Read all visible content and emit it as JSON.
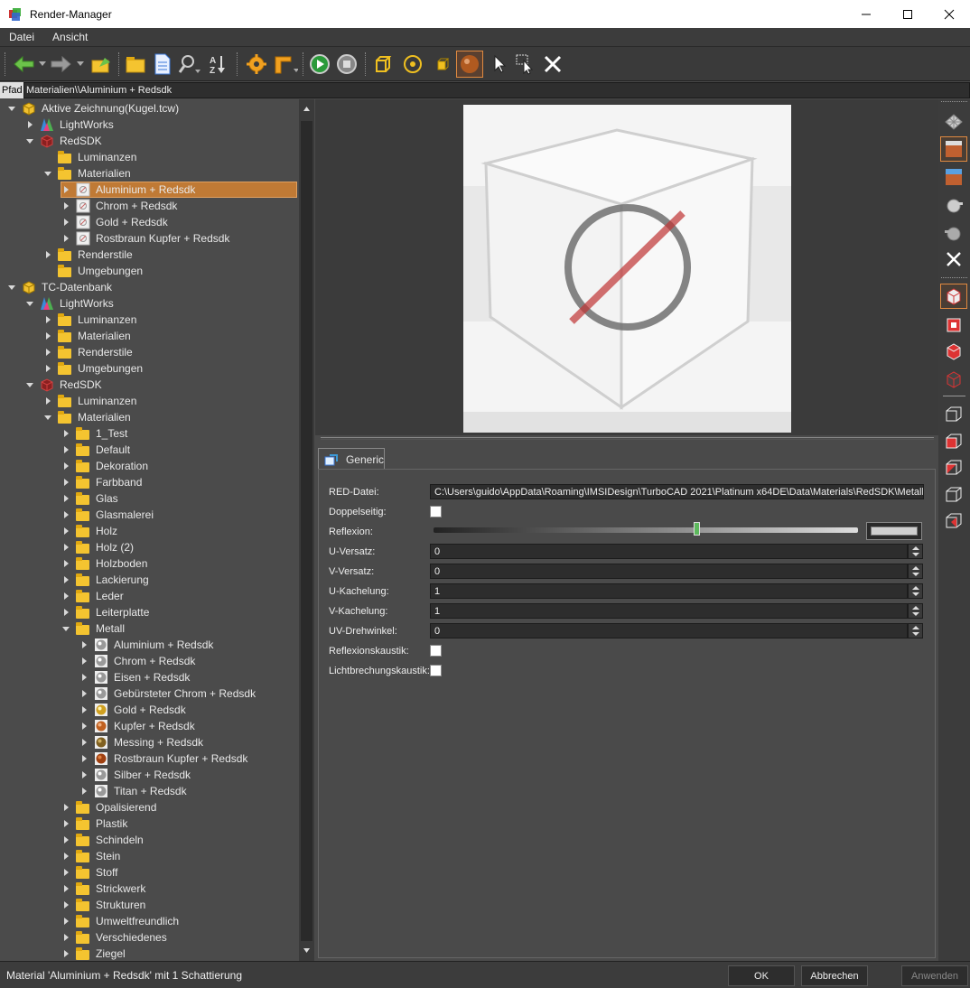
{
  "window": {
    "title": "Render-Manager"
  },
  "menu": [
    "Datei",
    "Ansicht"
  ],
  "path": {
    "label": "Pfad",
    "value": "Materialien\\\\Aluminium + Redsdk"
  },
  "tree": [
    {
      "label": "Aktive Zeichnung(Kugel.tcw)",
      "depth": 0,
      "state": "open",
      "icon": "drawing-icon"
    },
    {
      "label": "LightWorks",
      "depth": 1,
      "state": "closed",
      "icon": "lightworks-icon"
    },
    {
      "label": "RedSDK",
      "depth": 1,
      "state": "open",
      "icon": "redsdk-icon"
    },
    {
      "label": "Luminanzen",
      "depth": 2,
      "state": "none",
      "icon": "folder-icon"
    },
    {
      "label": "Materialien",
      "depth": 2,
      "state": "open",
      "icon": "folder-icon"
    },
    {
      "label": "Aluminium + Redsdk",
      "depth": 3,
      "state": "closed",
      "icon": "material-none-icon",
      "selected": true
    },
    {
      "label": "Chrom + Redsdk",
      "depth": 3,
      "state": "closed",
      "icon": "material-none-icon"
    },
    {
      "label": "Gold + Redsdk",
      "depth": 3,
      "state": "closed",
      "icon": "material-none-icon"
    },
    {
      "label": "Rostbraun Kupfer + Redsdk",
      "depth": 3,
      "state": "closed",
      "icon": "material-none-icon"
    },
    {
      "label": "Renderstile",
      "depth": 2,
      "state": "closed",
      "icon": "folder-icon"
    },
    {
      "label": "Umgebungen",
      "depth": 2,
      "state": "none",
      "icon": "folder-icon"
    },
    {
      "label": "TC-Datenbank",
      "depth": 0,
      "state": "open",
      "icon": "database-icon"
    },
    {
      "label": "LightWorks",
      "depth": 1,
      "state": "open",
      "icon": "lightworks-icon"
    },
    {
      "label": "Luminanzen",
      "depth": 2,
      "state": "closed",
      "icon": "folder-icon"
    },
    {
      "label": "Materialien",
      "depth": 2,
      "state": "closed",
      "icon": "folder-icon"
    },
    {
      "label": "Renderstile",
      "depth": 2,
      "state": "closed",
      "icon": "folder-icon"
    },
    {
      "label": "Umgebungen",
      "depth": 2,
      "state": "closed",
      "icon": "folder-icon"
    },
    {
      "label": "RedSDK",
      "depth": 1,
      "state": "open",
      "icon": "redsdk-icon"
    },
    {
      "label": "Luminanzen",
      "depth": 2,
      "state": "closed",
      "icon": "folder-icon"
    },
    {
      "label": "Materialien",
      "depth": 2,
      "state": "open",
      "icon": "folder-icon"
    },
    {
      "label": "1_Test",
      "depth": 3,
      "state": "closed",
      "icon": "folder-icon"
    },
    {
      "label": "Default",
      "depth": 3,
      "state": "closed",
      "icon": "folder-icon"
    },
    {
      "label": "Dekoration",
      "depth": 3,
      "state": "closed",
      "icon": "folder-icon"
    },
    {
      "label": "Farbband",
      "depth": 3,
      "state": "closed",
      "icon": "folder-icon"
    },
    {
      "label": "Glas",
      "depth": 3,
      "state": "closed",
      "icon": "folder-icon"
    },
    {
      "label": "Glasmalerei",
      "depth": 3,
      "state": "closed",
      "icon": "folder-icon"
    },
    {
      "label": "Holz",
      "depth": 3,
      "state": "closed",
      "icon": "folder-icon"
    },
    {
      "label": "Holz (2)",
      "depth": 3,
      "state": "closed",
      "icon": "folder-icon"
    },
    {
      "label": "Holzboden",
      "depth": 3,
      "state": "closed",
      "icon": "folder-icon"
    },
    {
      "label": "Lackierung",
      "depth": 3,
      "state": "closed",
      "icon": "folder-icon"
    },
    {
      "label": "Leder",
      "depth": 3,
      "state": "closed",
      "icon": "folder-icon"
    },
    {
      "label": "Leiterplatte",
      "depth": 3,
      "state": "closed",
      "icon": "folder-icon"
    },
    {
      "label": "Metall",
      "depth": 3,
      "state": "open",
      "icon": "folder-icon"
    },
    {
      "label": "Aluminium + Redsdk",
      "depth": 4,
      "state": "closed",
      "icon": "material-silver-icon"
    },
    {
      "label": "Chrom + Redsdk",
      "depth": 4,
      "state": "closed",
      "icon": "material-silver-icon"
    },
    {
      "label": "Eisen + Redsdk",
      "depth": 4,
      "state": "closed",
      "icon": "material-silver-icon"
    },
    {
      "label": "Gebürsteter Chrom + Redsdk",
      "depth": 4,
      "state": "closed",
      "icon": "material-silver-icon"
    },
    {
      "label": "Gold + Redsdk",
      "depth": 4,
      "state": "closed",
      "icon": "material-gold-icon"
    },
    {
      "label": "Kupfer + Redsdk",
      "depth": 4,
      "state": "closed",
      "icon": "material-copper-icon"
    },
    {
      "label": "Messing + Redsdk",
      "depth": 4,
      "state": "closed",
      "icon": "material-brass-icon"
    },
    {
      "label": "Rostbraun Kupfer + Redsdk",
      "depth": 4,
      "state": "closed",
      "icon": "material-rust-icon"
    },
    {
      "label": "Silber + Redsdk",
      "depth": 4,
      "state": "closed",
      "icon": "material-silver-icon"
    },
    {
      "label": "Titan + Redsdk",
      "depth": 4,
      "state": "closed",
      "icon": "material-silver-icon"
    },
    {
      "label": "Opalisierend",
      "depth": 3,
      "state": "closed",
      "icon": "folder-icon"
    },
    {
      "label": "Plastik",
      "depth": 3,
      "state": "closed",
      "icon": "folder-icon"
    },
    {
      "label": "Schindeln",
      "depth": 3,
      "state": "closed",
      "icon": "folder-icon"
    },
    {
      "label": "Stein",
      "depth": 3,
      "state": "closed",
      "icon": "folder-icon"
    },
    {
      "label": "Stoff",
      "depth": 3,
      "state": "closed",
      "icon": "folder-icon"
    },
    {
      "label": "Strickwerk",
      "depth": 3,
      "state": "closed",
      "icon": "folder-icon"
    },
    {
      "label": "Strukturen",
      "depth": 3,
      "state": "closed",
      "icon": "folder-icon"
    },
    {
      "label": "Umweltfreundlich",
      "depth": 3,
      "state": "closed",
      "icon": "folder-icon"
    },
    {
      "label": "Verschiedenes",
      "depth": 3,
      "state": "closed",
      "icon": "folder-icon"
    },
    {
      "label": "Ziegel",
      "depth": 3,
      "state": "closed",
      "icon": "folder-icon"
    }
  ],
  "tab": {
    "label": "Generic"
  },
  "properties": {
    "red_file": {
      "label": "RED-Datei:",
      "value": "C:\\Users\\guido\\AppData\\Roaming\\IMSIDesign\\TurboCAD 2021\\Platinum x64DE\\Data\\Materials\\RedSDK\\Metall Alu"
    },
    "double_sided": {
      "label": "Doppelseitig:",
      "checked": false
    },
    "reflection": {
      "label": "Reflexion:",
      "level": 0.62
    },
    "u_offset": {
      "label": "U-Versatz:",
      "value": "0"
    },
    "v_offset": {
      "label": "V-Versatz:",
      "value": "0"
    },
    "u_tiling": {
      "label": "U-Kachelung:",
      "value": "1"
    },
    "v_tiling": {
      "label": "V-Kachelung:",
      "value": "1"
    },
    "uv_rotation": {
      "label": "UV-Drehwinkel:",
      "value": "0"
    },
    "reflection_caustic": {
      "label": "Reflexionskaustik:",
      "checked": false
    },
    "refraction_caustic": {
      "label": "Lichtbrechungskaustik:",
      "checked": false
    }
  },
  "status": {
    "text": "Material 'Aluminium + Redsdk' mit 1 Schattierung"
  },
  "buttons": {
    "ok": "OK",
    "cancel": "Abbrechen",
    "apply": "Anwenden"
  },
  "colors": {
    "selection": "#c07a35",
    "folder": "#f4c430",
    "accent": "#e08a40"
  }
}
